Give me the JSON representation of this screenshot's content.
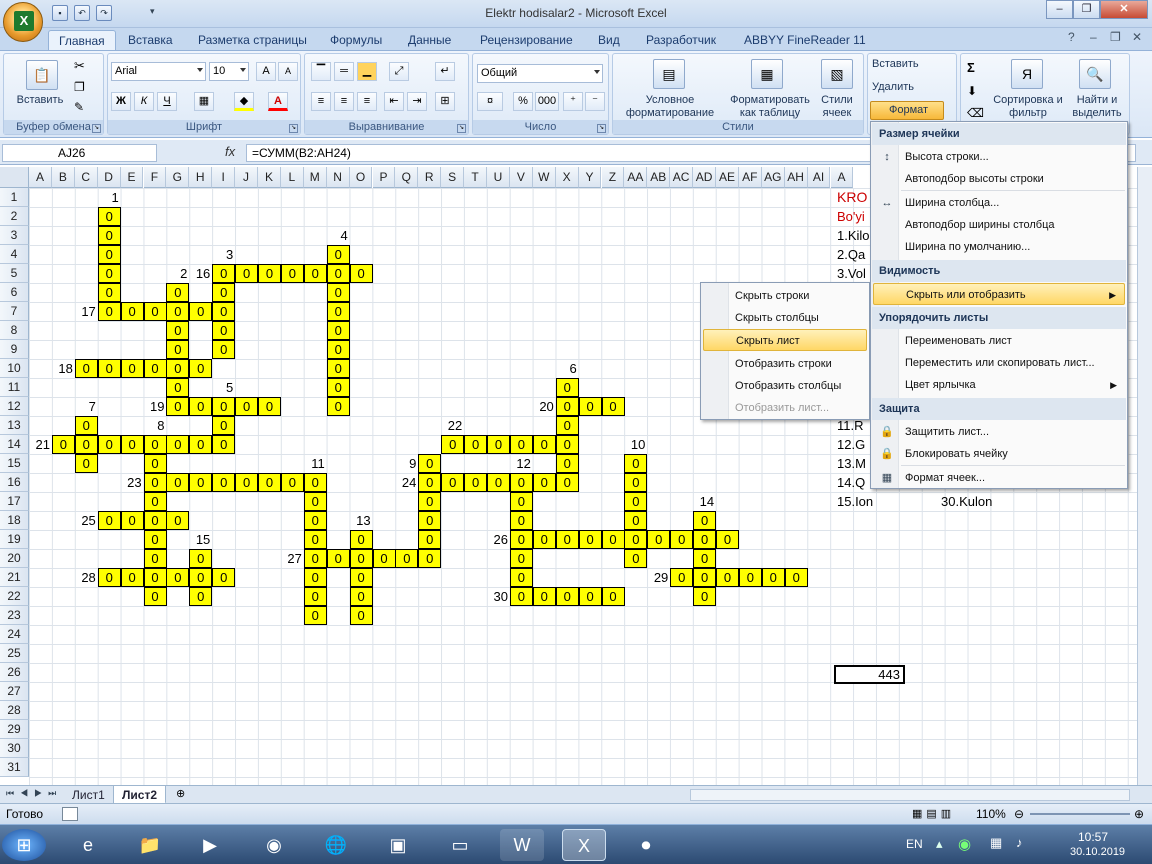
{
  "window": {
    "title": "Elektr hodisalar2 - Microsoft Excel"
  },
  "ribbon_tabs": [
    "Главная",
    "Вставка",
    "Разметка страницы",
    "Формулы",
    "Данные",
    "Рецензирование",
    "Вид",
    "Разработчик",
    "ABBYY FineReader 11"
  ],
  "ribbon": {
    "clipboard": {
      "paste": "Вставить",
      "label": "Буфер обмена"
    },
    "font": {
      "name": "Arial",
      "size": "10",
      "label": "Шрифт",
      "bold": "Ж",
      "italic": "К",
      "underline": "Ч"
    },
    "alignment": {
      "label": "Выравнивание"
    },
    "number": {
      "format": "Общий",
      "label": "Число",
      "percent": "%",
      "thousands": "000"
    },
    "styles": {
      "conditional": "Условное форматирование",
      "as_table": "Форматировать как таблицу",
      "cell_styles": "Стили ячеек",
      "label": "Стили"
    },
    "cells": {
      "insert": "Вставить",
      "delete": "Удалить",
      "format": "Формат"
    },
    "editing": {
      "sort": "Сортировка и фильтр",
      "find": "Найти и выделить",
      "sigma": "Σ"
    }
  },
  "formula_bar": {
    "name_box": "AJ26",
    "fx": "fx",
    "formula": "=СУММ(B2:AH24)"
  },
  "columns": [
    "A",
    "B",
    "C",
    "D",
    "E",
    "F",
    "G",
    "H",
    "I",
    "J",
    "K",
    "L",
    "M",
    "N",
    "O",
    "P",
    "Q",
    "R",
    "S",
    "T",
    "U",
    "V",
    "W",
    "X",
    "Y",
    "Z",
    "AA",
    "AB",
    "AC",
    "AD",
    "AE",
    "AF",
    "AG",
    "AH",
    "AI",
    "A"
  ],
  "rows": [
    "1",
    "2",
    "3",
    "4",
    "5",
    "6",
    "7",
    "8",
    "9",
    "10",
    "11",
    "12",
    "13",
    "14",
    "15",
    "16",
    "17",
    "18",
    "19",
    "20",
    "21",
    "22",
    "23",
    "24",
    "25",
    "26",
    "27",
    "28",
    "29",
    "30",
    "31"
  ],
  "right_text": {
    "r1": "KRO",
    "r2": "Bo'yi",
    "r3": "1.Kilo",
    "r4": "2.Qa",
    "r5": "3.Vol",
    "r13": "11.R",
    "r14": "12.G",
    "r15": "13.M",
    "r16": "14.Q",
    "r17a": "15.Ion",
    "r17b": "30.Kulon"
  },
  "sum_value": "443",
  "context_menu": {
    "items": [
      "Скрыть строки",
      "Скрыть столбцы",
      "Скрыть лист",
      "Отобразить строки",
      "Отобразить столбцы",
      "Отобразить лист..."
    ]
  },
  "format_menu": {
    "h1": "Размер ячейки",
    "i1": "Высота строки...",
    "i2": "Автоподбор высоты строки",
    "i3": "Ширина столбца...",
    "i4": "Автоподбор ширины столбца",
    "i5": "Ширина по умолчанию...",
    "h2": "Видимость",
    "i6": "Скрыть или отобразить",
    "h3": "Упорядочить листы",
    "i7": "Переименовать лист",
    "i8": "Переместить или скопировать лист...",
    "i9": "Цвет ярлычка",
    "h4": "Защита",
    "i10": "Защитить лист...",
    "i11": "Блокировать ячейку",
    "i12": "Формат ячеек..."
  },
  "sheets": [
    "Лист1",
    "Лист2"
  ],
  "status": {
    "ready": "Готово",
    "zoom": "110%"
  },
  "taskbar": {
    "lang": "EN",
    "time": "10:57",
    "date": "30.10.2019"
  }
}
